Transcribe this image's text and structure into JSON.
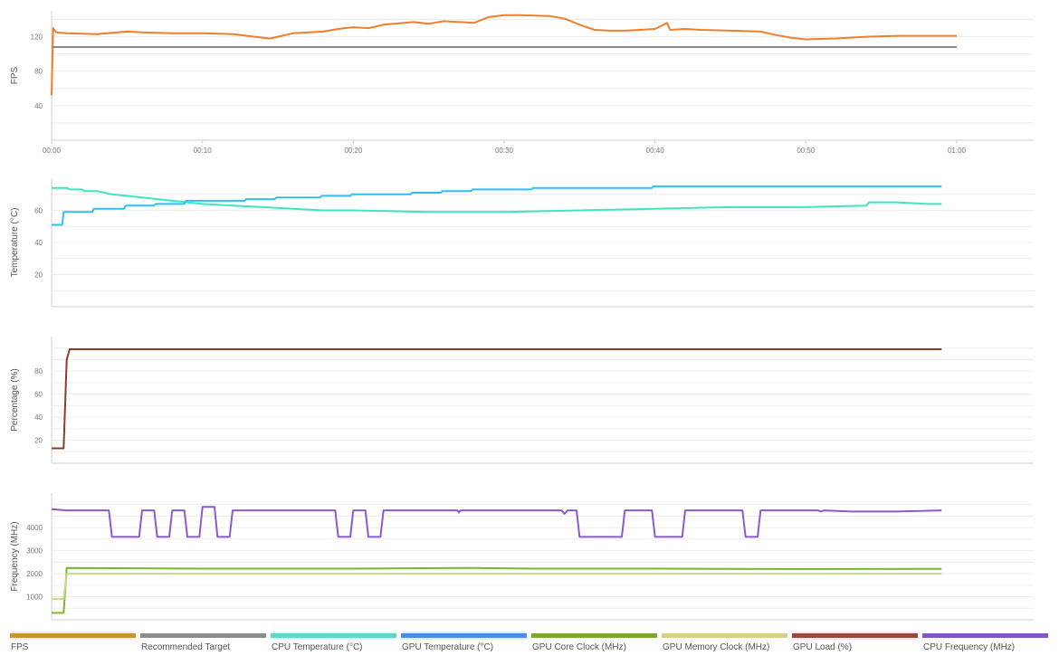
{
  "chart_data": [
    {
      "type": "line",
      "ylabel": "FPS",
      "ylim": [
        0,
        150
      ],
      "yticks": [
        40,
        80,
        120
      ],
      "xlim": [
        0,
        65
      ],
      "xticks": [
        "00:00",
        "00:10",
        "00:20",
        "00:30",
        "00:40",
        "00:50",
        "01:00"
      ],
      "x_unit": "minutes",
      "grid": true,
      "series": [
        {
          "name": "FPS",
          "color": "#f07f2c",
          "points": [
            [
              0,
              52
            ],
            [
              0.1,
              130
            ],
            [
              0.3,
              125
            ],
            [
              1,
              124
            ],
            [
              3,
              123
            ],
            [
              5,
              126
            ],
            [
              6,
              125
            ],
            [
              8,
              124
            ],
            [
              10,
              124
            ],
            [
              12,
              123
            ],
            [
              14,
              119
            ],
            [
              14.5,
              118
            ],
            [
              15,
              120
            ],
            [
              16,
              124
            ],
            [
              18,
              126
            ],
            [
              19,
              129
            ],
            [
              20,
              131
            ],
            [
              21,
              130
            ],
            [
              22,
              134
            ],
            [
              24,
              137
            ],
            [
              25,
              135
            ],
            [
              26,
              138
            ],
            [
              28,
              136
            ],
            [
              29,
              143
            ],
            [
              30,
              145
            ],
            [
              31,
              145
            ],
            [
              33,
              144
            ],
            [
              34,
              141
            ],
            [
              35,
              134
            ],
            [
              36,
              128
            ],
            [
              37,
              127
            ],
            [
              38,
              127
            ],
            [
              39,
              128
            ],
            [
              40,
              129
            ],
            [
              40.8,
              136
            ],
            [
              41,
              128
            ],
            [
              42,
              129
            ],
            [
              43,
              128
            ],
            [
              45,
              127
            ],
            [
              47,
              126
            ],
            [
              48,
              122
            ],
            [
              49,
              119
            ],
            [
              50,
              117
            ],
            [
              52,
              118
            ],
            [
              54,
              120
            ],
            [
              56,
              121
            ],
            [
              58,
              121
            ],
            [
              60,
              121
            ]
          ]
        },
        {
          "name": "Recommended Target",
          "color": "#888888",
          "points": [
            [
              0,
              108
            ],
            [
              60,
              108
            ]
          ]
        }
      ]
    },
    {
      "type": "line",
      "ylabel": "Temperature (°C)",
      "ylim": [
        0,
        80
      ],
      "yticks": [
        20,
        40,
        60
      ],
      "xlim": [
        0,
        65
      ],
      "grid": true,
      "series": [
        {
          "name": "CPU Temperature (°C)",
          "color": "#3ee6c0",
          "points": [
            [
              0,
              74
            ],
            [
              1,
              74
            ],
            [
              1.2,
              73
            ],
            [
              2,
              73
            ],
            [
              2.2,
              72
            ],
            [
              3,
              72
            ],
            [
              4,
              70
            ],
            [
              5,
              69
            ],
            [
              6,
              68
            ],
            [
              7,
              67
            ],
            [
              8,
              66
            ],
            [
              10,
              64
            ],
            [
              12,
              63
            ],
            [
              14,
              62
            ],
            [
              16,
              61
            ],
            [
              18,
              60
            ],
            [
              20,
              60
            ],
            [
              25,
              59
            ],
            [
              30,
              59
            ],
            [
              35,
              60
            ],
            [
              40,
              61
            ],
            [
              45,
              62
            ],
            [
              50,
              62
            ],
            [
              54,
              63
            ],
            [
              54.2,
              65
            ],
            [
              56,
              65
            ],
            [
              58,
              64
            ],
            [
              59,
              64
            ]
          ]
        },
        {
          "name": "GPU Temperature (°C)",
          "color": "#2fc0ee",
          "points": [
            [
              0,
              51
            ],
            [
              0.7,
              51
            ],
            [
              0.8,
              59
            ],
            [
              2.7,
              59
            ],
            [
              2.8,
              61
            ],
            [
              4.8,
              61
            ],
            [
              4.9,
              63
            ],
            [
              6.8,
              63
            ],
            [
              6.9,
              64
            ],
            [
              8.8,
              64
            ],
            [
              8.9,
              66
            ],
            [
              12.8,
              66
            ],
            [
              12.9,
              67
            ],
            [
              14.8,
              67
            ],
            [
              14.9,
              68
            ],
            [
              17.8,
              68
            ],
            [
              17.9,
              69
            ],
            [
              19.8,
              69
            ],
            [
              19.9,
              70
            ],
            [
              23.8,
              70
            ],
            [
              23.9,
              71
            ],
            [
              25.8,
              71
            ],
            [
              25.9,
              72
            ],
            [
              27.8,
              72
            ],
            [
              27.9,
              73
            ],
            [
              31.8,
              73
            ],
            [
              31.9,
              74
            ],
            [
              39.8,
              74
            ],
            [
              39.9,
              75
            ],
            [
              59,
              75
            ]
          ]
        }
      ]
    },
    {
      "type": "line",
      "ylabel": "Percentage (%)",
      "ylim": [
        0,
        110
      ],
      "yticks": [
        20,
        40,
        60,
        80
      ],
      "xlim": [
        0,
        65
      ],
      "grid": true,
      "series": [
        {
          "name": "GPU Load (%)",
          "color": "#8b3d2b",
          "points": [
            [
              0,
              13
            ],
            [
              0.8,
              13
            ],
            [
              1.0,
              90
            ],
            [
              1.2,
              99
            ],
            [
              59,
              99
            ]
          ]
        }
      ]
    },
    {
      "type": "line",
      "ylabel": "Frequency (MHz)",
      "ylim": [
        0,
        5500
      ],
      "yticks": [
        1000,
        2000,
        3000,
        4000
      ],
      "xlim": [
        0,
        65
      ],
      "grid": true,
      "series": [
        {
          "name": "GPU Core Clock (MHz)",
          "color": "#7bb62e",
          "points": [
            [
              0,
              300
            ],
            [
              0.8,
              300
            ],
            [
              1.0,
              2250
            ],
            [
              10,
              2220
            ],
            [
              20,
              2220
            ],
            [
              28,
              2250
            ],
            [
              32,
              2220
            ],
            [
              40,
              2220
            ],
            [
              50,
              2200
            ],
            [
              59,
              2210
            ]
          ]
        },
        {
          "name": "GPU Memory Clock (MHz)",
          "color": "#c5d98a",
          "points": [
            [
              0,
              900
            ],
            [
              0.8,
              900
            ],
            [
              1.0,
              2000
            ],
            [
              59,
              2000
            ]
          ]
        },
        {
          "name": "CPU Frequency (MHz)",
          "color": "#8a5bd0",
          "points": [
            [
              0,
              4800
            ],
            [
              1,
              4750
            ],
            [
              3.8,
              4750
            ],
            [
              4,
              3600
            ],
            [
              5.8,
              3600
            ],
            [
              6,
              4750
            ],
            [
              6.8,
              4750
            ],
            [
              7,
              3600
            ],
            [
              7.8,
              3600
            ],
            [
              8,
              4750
            ],
            [
              8.8,
              4750
            ],
            [
              9,
              3600
            ],
            [
              9.8,
              3600
            ],
            [
              10,
              4900
            ],
            [
              10.8,
              4900
            ],
            [
              11,
              3600
            ],
            [
              11.8,
              3600
            ],
            [
              12,
              4750
            ],
            [
              18.8,
              4750
            ],
            [
              19,
              3600
            ],
            [
              19.8,
              3600
            ],
            [
              20,
              4750
            ],
            [
              20.8,
              4750
            ],
            [
              21,
              3600
            ],
            [
              21.8,
              3600
            ],
            [
              22,
              4750
            ],
            [
              26.9,
              4750
            ],
            [
              27,
              4650
            ],
            [
              27.1,
              4750
            ],
            [
              33.8,
              4750
            ],
            [
              34,
              4600
            ],
            [
              34.2,
              4750
            ],
            [
              34.8,
              4750
            ],
            [
              35,
              3600
            ],
            [
              37.8,
              3600
            ],
            [
              38,
              4750
            ],
            [
              39.8,
              4750
            ],
            [
              40,
              3600
            ],
            [
              41.8,
              3600
            ],
            [
              42,
              4750
            ],
            [
              45.8,
              4750
            ],
            [
              46,
              3600
            ],
            [
              46.8,
              3600
            ],
            [
              47,
              4750
            ],
            [
              50.8,
              4750
            ],
            [
              51,
              4700
            ],
            [
              51.2,
              4750
            ],
            [
              53,
              4700
            ],
            [
              56,
              4700
            ],
            [
              59,
              4750
            ]
          ]
        }
      ]
    }
  ],
  "legend": [
    {
      "label": "FPS",
      "color": "#c9962e",
      "glow": "#f7b8d8"
    },
    {
      "label": "Recommended Target",
      "color": "#8c8c8c",
      "glow": ""
    },
    {
      "label": "CPU Temperature (°C)",
      "color": "#63d4c6",
      "glow": "#9ff2f0"
    },
    {
      "label": "GPU Temperature (°C)",
      "color": "#4a8ce8",
      "glow": "#9bd6f5"
    },
    {
      "label": "GPU Core Clock (MHz)",
      "color": "#7aa832",
      "glow": ""
    },
    {
      "label": "GPU Memory Clock (MHz)",
      "color": "#d8d08a",
      "glow": ""
    },
    {
      "label": "GPU Load (%)",
      "color": "#9a4a3a",
      "glow": "#f7b8d8"
    },
    {
      "label": "CPU Frequency (MHz)",
      "color": "#7f55c8",
      "glow": ""
    }
  ]
}
